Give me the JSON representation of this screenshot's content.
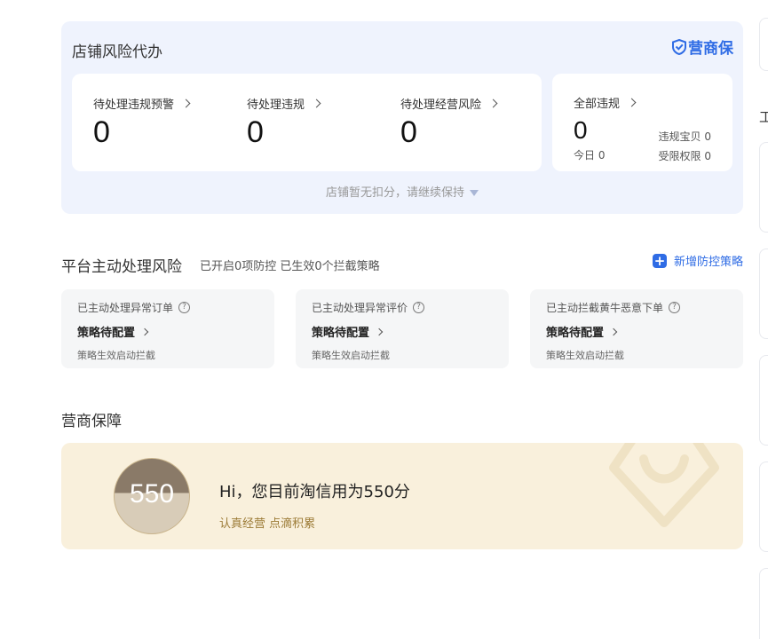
{
  "risk": {
    "title": "店铺风险代办",
    "brand": "营商保",
    "stats": [
      {
        "label": "待处理违规预警",
        "value": "0"
      },
      {
        "label": "待处理违规",
        "value": "0"
      },
      {
        "label": "待处理经营风险",
        "value": "0"
      }
    ],
    "all": {
      "label": "全部违规",
      "value": "0",
      "today": "今日 0",
      "violation_items": "违规宝贝 0",
      "restricted": "受限权限 0"
    },
    "footer": "店铺暂无扣分，请继续保持"
  },
  "platform": {
    "title": "平台主动处理风险",
    "subtitle": "已开启0项防控 已生效0个拦截策略",
    "add_label": "新增防控策略",
    "cards": [
      {
        "title": "已主动处理异常订单",
        "link": "策略待配置",
        "desc": "策略生效启动拦截"
      },
      {
        "title": "已主动处理异常评价",
        "link": "策略待配置",
        "desc": "策略生效启动拦截"
      },
      {
        "title": "已主动拦截黄牛恶意下单",
        "link": "策略待配置",
        "desc": "策略生效启动拦截"
      }
    ]
  },
  "guarantee": {
    "title": "营商保障",
    "score": "550",
    "greeting": "Hi，您目前淘信用为550分",
    "motto": "认真经营 点滴积累"
  },
  "edge": {
    "char": "工"
  },
  "colors": {
    "accent": "#2f6ce5",
    "risk_bg": "#eff3fd",
    "guarantee_bg": "#f9f0dc",
    "motto": "#9b7a35"
  }
}
